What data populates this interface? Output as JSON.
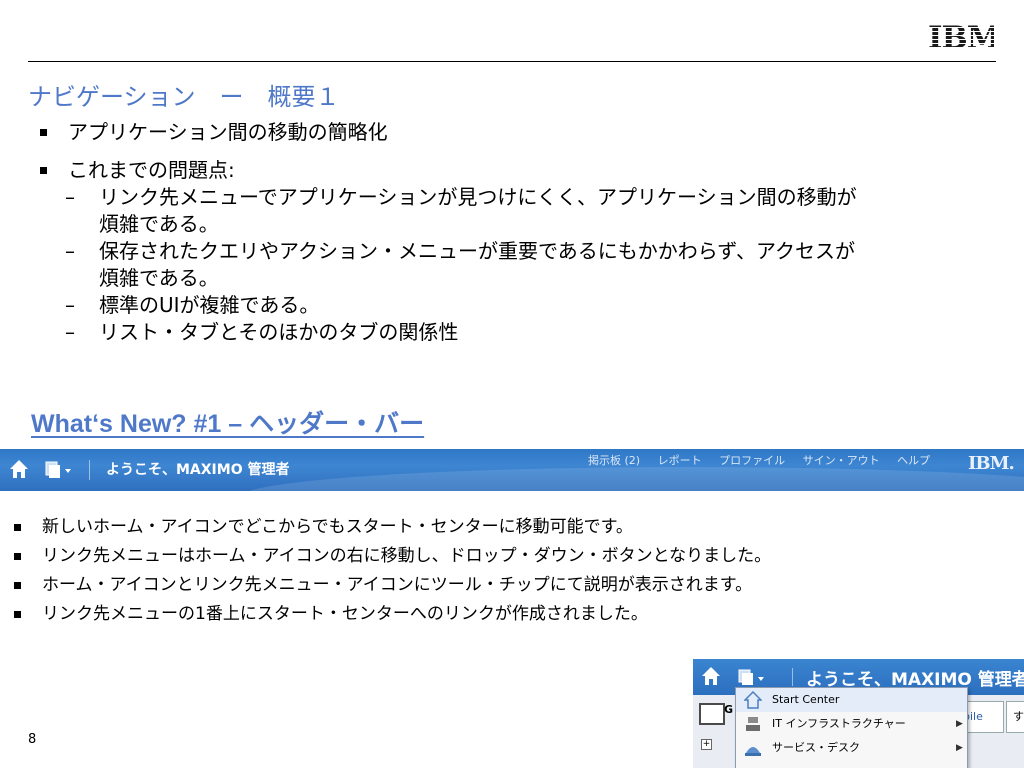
{
  "logo": {
    "text": "IBM"
  },
  "slide": {
    "title": "ナビゲーション　ー　概要１",
    "bullets": [
      {
        "text": "アプリケーション間の移動の簡略化",
        "subs": []
      },
      {
        "text": "これまでの問題点:",
        "subs": [
          "リンク先メニューでアプリケーションが見つけにくく、アプリケーション間の移動が",
          "煩雑である。",
          "保存されたクエリやアクション・メニューが重要であるにもかかわらず、アクセスが",
          "煩雑である。",
          "標準のUIが複雑である。",
          "リスト・タブとそのほかのタブの関係性"
        ]
      }
    ],
    "whats_new_heading": "What‘s New? #1 – ヘッダー・バー",
    "header_bar": {
      "welcome": "ようこそ、MAXIMO 管理者",
      "links": [
        "掲示板 (2)",
        "レポート",
        "プロファイル",
        "サイン・アウト",
        "ヘルプ"
      ],
      "brand": "IBM."
    },
    "notes": [
      "新しいホーム・アイコンでどこからでもスタート・センターに移動可能です。",
      "リンク先メニューはホーム・アイコンの右に移動し、ドロップ・ダウン・ボタンとなりました。",
      "ホーム・アイコンとリンク先メニュー・アイコンにツール・チップにて説明が表示されます。",
      "リンク先メニューの1番上にスタート・センターへのリンクが作成されました。"
    ],
    "page_number": "8"
  },
  "mini_screenshot": {
    "welcome": "ようこそ、MAXIMO 管理者",
    "tab_partial": "bile",
    "tab2_partial": "す",
    "bg_label": "G",
    "dropdown_items": [
      "Start Center",
      "IT インフラストラクチャー",
      "サービス・デスク"
    ]
  },
  "colors": {
    "title_blue": "#4f78c9",
    "header_blue": "#2f78c6"
  }
}
